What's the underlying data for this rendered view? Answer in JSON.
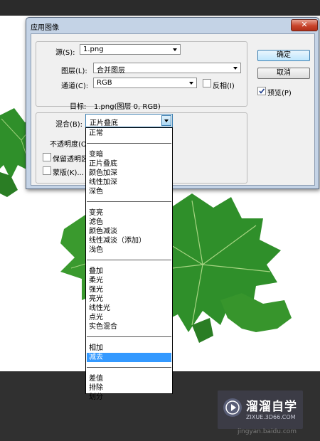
{
  "dialog": {
    "title": "应用图像",
    "close_glyph": "✕",
    "source": {
      "label": "源(S):",
      "value": "1.png"
    },
    "layer": {
      "label": "图层(L):",
      "value": "合并图层"
    },
    "channel": {
      "label": "通道(C):",
      "value": "RGB"
    },
    "invert": {
      "label": "反相(I)",
      "checked": false
    },
    "target": {
      "label": "目标:",
      "value": "1.png(图层 0, RGB)"
    },
    "blending": {
      "label": "混合(B):",
      "value": "正片叠底"
    },
    "opacity": {
      "label": "不透明度(O)"
    },
    "preserve_transparency": {
      "label": "保留透明区",
      "checked": false
    },
    "mask": {
      "label": "蒙版(K)...",
      "checked": false
    },
    "buttons": {
      "ok": "确定",
      "cancel": "取消"
    },
    "preview": {
      "label": "预览(P)",
      "checked": true
    }
  },
  "blend_modes": [
    [
      "正常"
    ],
    [
      "变暗",
      "正片叠底",
      "颜色加深",
      "线性加深",
      "深色"
    ],
    [
      "变亮",
      "滤色",
      "颜色减淡",
      "线性减淡（添加）",
      "浅色"
    ],
    [
      "叠加",
      "柔光",
      "强光",
      "亮光",
      "线性光",
      "点光",
      "实色混合"
    ],
    [
      "相加",
      "减去"
    ],
    [
      "差值",
      "排除",
      "划分"
    ]
  ],
  "highlighted_mode": "减去",
  "watermark": {
    "brand": "溜溜自学",
    "domain": "ZIXUE.3D66.COM",
    "site": "jingyan.baidu.com"
  },
  "colors": {
    "dialog_frame": "#c4d3e6",
    "selection": "#3399ff",
    "leaf_green": "#2f8f2a"
  }
}
